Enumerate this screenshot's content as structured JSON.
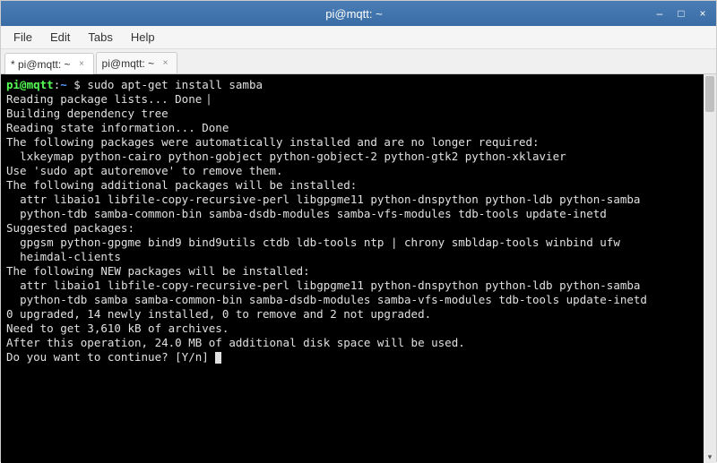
{
  "window": {
    "title": "pi@mqtt: ~"
  },
  "menu": {
    "file": "File",
    "edit": "Edit",
    "tabs": "Tabs",
    "help": "Help"
  },
  "tabs": [
    {
      "label": "* pi@mqtt: ~",
      "active": true
    },
    {
      "label": "pi@mqtt: ~",
      "active": false
    }
  ],
  "prompt": {
    "user_host": "pi@mqtt",
    "colon": ":",
    "path": "~",
    "dollar": " $ "
  },
  "command": "sudo apt-get install samba",
  "output_lines": [
    "Reading package lists... Done",
    "Building dependency tree",
    "Reading state information... Done",
    "The following packages were automatically installed and are no longer required:",
    "  lxkeymap python-cairo python-gobject python-gobject-2 python-gtk2 python-xklavier",
    "Use 'sudo apt autoremove' to remove them.",
    "The following additional packages will be installed:",
    "  attr libaio1 libfile-copy-recursive-perl libgpgme11 python-dnspython python-ldb python-samba",
    "  python-tdb samba-common-bin samba-dsdb-modules samba-vfs-modules tdb-tools update-inetd",
    "Suggested packages:",
    "  gpgsm python-gpgme bind9 bind9utils ctdb ldb-tools ntp | chrony smbldap-tools winbind ufw",
    "  heimdal-clients",
    "The following NEW packages will be installed:",
    "  attr libaio1 libfile-copy-recursive-perl libgpgme11 python-dnspython python-ldb python-samba",
    "  python-tdb samba samba-common-bin samba-dsdb-modules samba-vfs-modules tdb-tools update-inetd",
    "0 upgraded, 14 newly installed, 0 to remove and 2 not upgraded.",
    "Need to get 3,610 kB of archives.",
    "After this operation, 24.0 MB of additional disk space will be used.",
    "Do you want to continue? [Y/n] "
  ],
  "icons": {
    "minimize": "–",
    "maximize": "□",
    "close": "×",
    "tab_close": "×",
    "scroll_down": "▾"
  }
}
